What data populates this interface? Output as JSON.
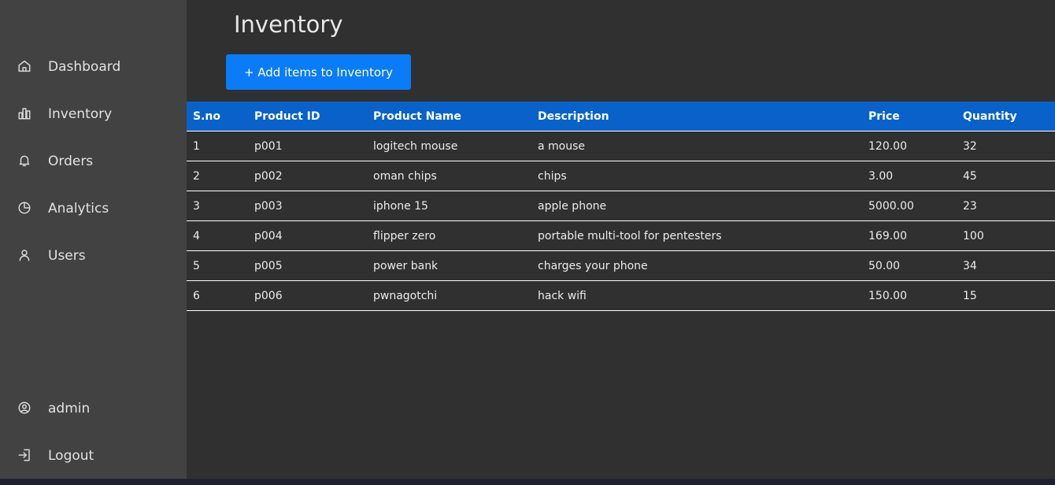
{
  "sidebar": {
    "items": [
      {
        "label": "Dashboard",
        "icon": "home-icon"
      },
      {
        "label": "Inventory",
        "icon": "bar-chart-icon"
      },
      {
        "label": "Orders",
        "icon": "bell-icon"
      },
      {
        "label": "Analytics",
        "icon": "pie-chart-icon"
      },
      {
        "label": "Users",
        "icon": "user-icon"
      }
    ],
    "footer": [
      {
        "label": "admin",
        "icon": "user-circle-icon"
      },
      {
        "label": "Logout",
        "icon": "logout-icon"
      }
    ]
  },
  "main": {
    "title": "Inventory",
    "add_button_label": "+ Add items to Inventory",
    "table": {
      "columns": [
        "S.no",
        "Product ID",
        "Product Name",
        "Description",
        "Price",
        "Quantity"
      ],
      "rows": [
        [
          "1",
          "p001",
          "logitech mouse",
          "a mouse",
          "120.00",
          "32"
        ],
        [
          "2",
          "p002",
          "oman chips",
          "chips",
          "3.00",
          "45"
        ],
        [
          "3",
          "p003",
          "iphone 15",
          "apple phone",
          "5000.00",
          "23"
        ],
        [
          "4",
          "p004",
          "flipper zero",
          "portable multi-tool for pentesters",
          "169.00",
          "100"
        ],
        [
          "5",
          "p005",
          "power bank",
          "charges your phone",
          "50.00",
          "34"
        ],
        [
          "6",
          "p006",
          "pwnagotchi",
          "hack wifi",
          "150.00",
          "15"
        ]
      ]
    }
  },
  "colors": {
    "sidebar_bg": "#424242",
    "main_bg": "#303030",
    "accent": "#0b7cf7",
    "table_header_bg": "#0862c9"
  }
}
